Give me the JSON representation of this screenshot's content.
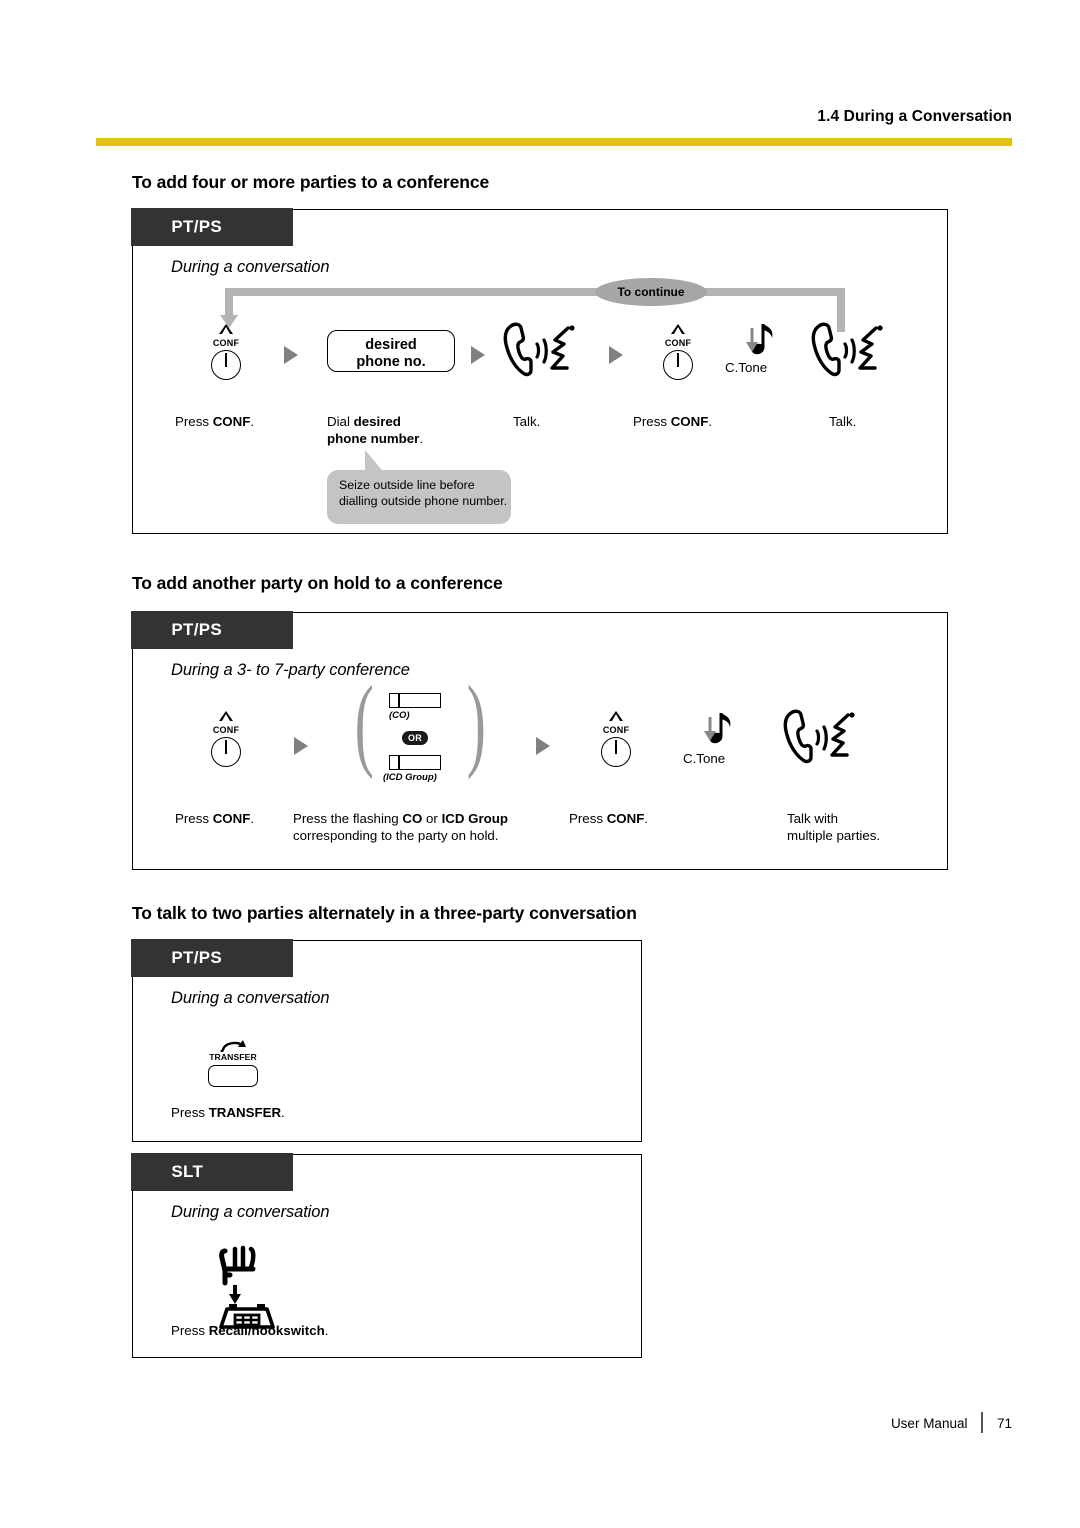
{
  "header": {
    "running_head": "1.4 During a Conversation",
    "rule_color": "#E3C308"
  },
  "sections": [
    {
      "title": "To add four or more parties to a conference",
      "panel_tag": "PT/PS",
      "subcaption": "During a conversation",
      "loop_badge": "To continue",
      "steps": [
        {
          "icon": "conf-key-icon",
          "icon_label": "CONF",
          "caption_plain_1": "Press ",
          "caption_bold": "CONF",
          "caption_plain_2": "."
        },
        {
          "icon": "dial-box-icon",
          "box_line1": "desired",
          "box_line2": "phone no.",
          "caption_plain_1": "Dial ",
          "caption_bold": "desired phone number",
          "caption_plain_2": "."
        },
        {
          "icon": "talk-handset-icon",
          "caption_plain_1": "Talk.",
          "caption_bold": "",
          "caption_plain_2": ""
        },
        {
          "icon": "conf-key-icon",
          "icon_label": "CONF",
          "caption_plain_1": "Press ",
          "caption_bold": "CONF",
          "caption_plain_2": "."
        },
        {
          "icon": "confirmation-tone-icon",
          "tone_label": "C.Tone"
        },
        {
          "icon": "talk-handset-icon",
          "caption_plain_1": "Talk.",
          "caption_bold": "",
          "caption_plain_2": ""
        }
      ],
      "callout": {
        "line1": "Seize outside line before",
        "line2": "dialling outside phone number."
      }
    },
    {
      "title": "To add another party on hold to a conference",
      "panel_tag": "PT/PS",
      "subcaption": "During a 3- to 7-party conference",
      "steps": [
        {
          "icon": "conf-key-icon",
          "icon_label": "CONF",
          "caption_plain_1": "Press ",
          "caption_bold": "CONF",
          "caption_plain_2": "."
        },
        {
          "icon": "co-or-icd-group-icon",
          "co_label": "(CO)",
          "or_label": "OR",
          "icd_label": "(ICD Group)",
          "caption_line1_plain_1": "Press the flashing ",
          "caption_line1_bold_1": "CO",
          "caption_line1_plain_2": " or ",
          "caption_line1_bold_2": "ICD Group",
          "caption_line2": "corresponding to the party on hold."
        },
        {
          "icon": "conf-key-icon",
          "icon_label": "CONF",
          "caption_plain_1": "Press ",
          "caption_bold": "CONF",
          "caption_plain_2": "."
        },
        {
          "icon": "confirmation-tone-icon",
          "tone_label": "C.Tone"
        },
        {
          "icon": "talk-handset-icon",
          "caption_line1": "Talk with",
          "caption_line2": "multiple parties."
        }
      ]
    },
    {
      "title": "To talk to two parties alternately in a three-party conversation",
      "panels": [
        {
          "panel_tag": "PT/PS",
          "subcaption": "During a conversation",
          "steps": [
            {
              "icon": "transfer-key-icon",
              "icon_label": "TRANSFER",
              "caption_plain_1": "Press ",
              "caption_bold": "TRANSFER",
              "caption_plain_2": "."
            }
          ]
        },
        {
          "panel_tag": "SLT",
          "subcaption": "During a conversation",
          "steps": [
            {
              "icon": "recall-hookswitch-icon",
              "caption_plain_1": "Press ",
              "caption_bold": "Recall/hookswitch",
              "caption_plain_2": "."
            }
          ]
        }
      ]
    }
  ],
  "footer": {
    "document_name": "User Manual",
    "page_number": "71"
  }
}
